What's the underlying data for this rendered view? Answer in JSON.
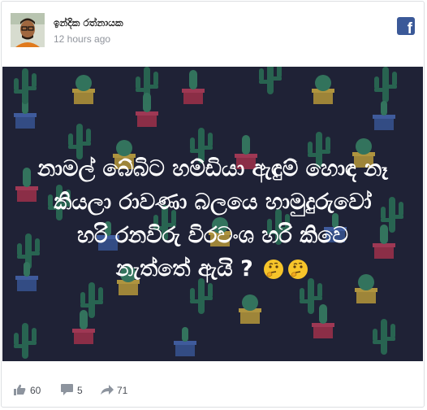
{
  "post": {
    "author": "ඉන්දික රත්නායක",
    "time": "12 hours ago",
    "text_lines": [
      "නාමල් බේබිට හම්ඩියා ඇඳුම් හොඳ නෑ",
      "කියලා රාවණා බලයෙ හාමුදුරුවෝ",
      "හරි රනවිරු විරවංශ හරි කිවෙ",
      "නැත්තේ ඇයි ?"
    ]
  },
  "footer": {
    "likes": "60",
    "comments": "5",
    "shares": "71"
  },
  "icons": {
    "brand": "facebook-icon",
    "like": "thumbs-up-icon",
    "comment": "comment-icon",
    "share": "share-arrow-icon",
    "emoji": "thinking-face-emoji"
  },
  "colors": {
    "facebook_blue": "#3b5998",
    "image_background": "#1f2236",
    "post_text": "#ffffff"
  }
}
